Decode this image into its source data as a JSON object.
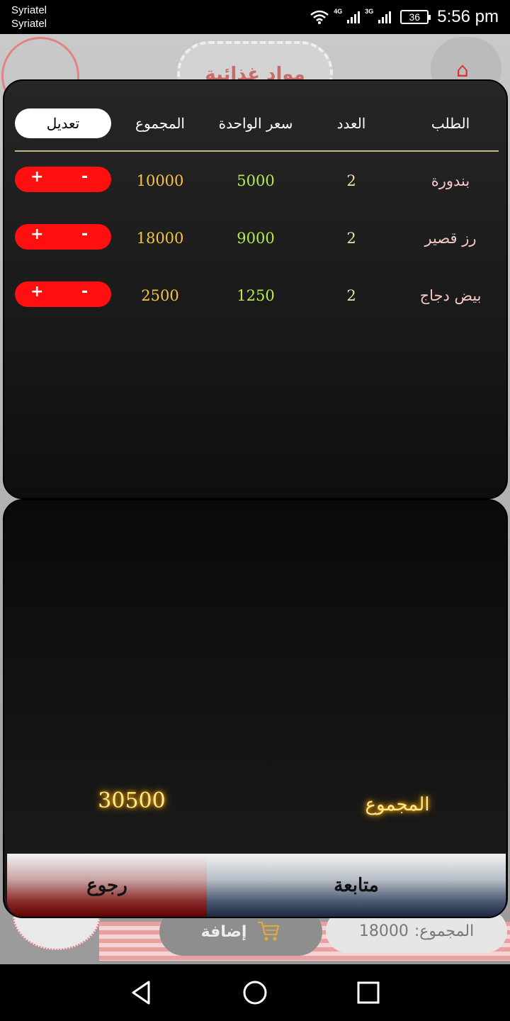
{
  "status_bar": {
    "carrier_1": "Syriatel",
    "carrier_2": "Syriatel",
    "network_1": "4G",
    "network_2": "3G",
    "battery": "36",
    "time": "5:56 pm"
  },
  "background_app": {
    "header_title": "مواد غذائية",
    "add_button_label": "إضافة",
    "total_label": "المجموع:",
    "total_value": "18000"
  },
  "table": {
    "headers": {
      "item": "الطلب",
      "quantity": "العدد",
      "unit_price": "سعر الواحدة",
      "total": "المجموع",
      "edit": "تعديل"
    },
    "rows": [
      {
        "item": "بندورة",
        "quantity": "2",
        "unit_price": "5000",
        "total": "10000",
        "plus": "+",
        "minus": "-"
      },
      {
        "item": "رز قصير",
        "quantity": "2",
        "unit_price": "9000",
        "total": "18000",
        "plus": "+",
        "minus": "-"
      },
      {
        "item": "بيض دجاج",
        "quantity": "2",
        "unit_price": "1250",
        "total": "2500",
        "plus": "+",
        "minus": "-"
      }
    ]
  },
  "summary": {
    "label": "المجموع",
    "value": "30500"
  },
  "actions": {
    "back_label": "رجوع",
    "continue_label": "متابعة"
  },
  "colors": {
    "item_text": "#f4c6c6",
    "unit_price_text": "#b7ea4c",
    "total_text": "#f5c542",
    "stepper_bg": "#ff0f0f",
    "divider": "#c9b98a"
  }
}
